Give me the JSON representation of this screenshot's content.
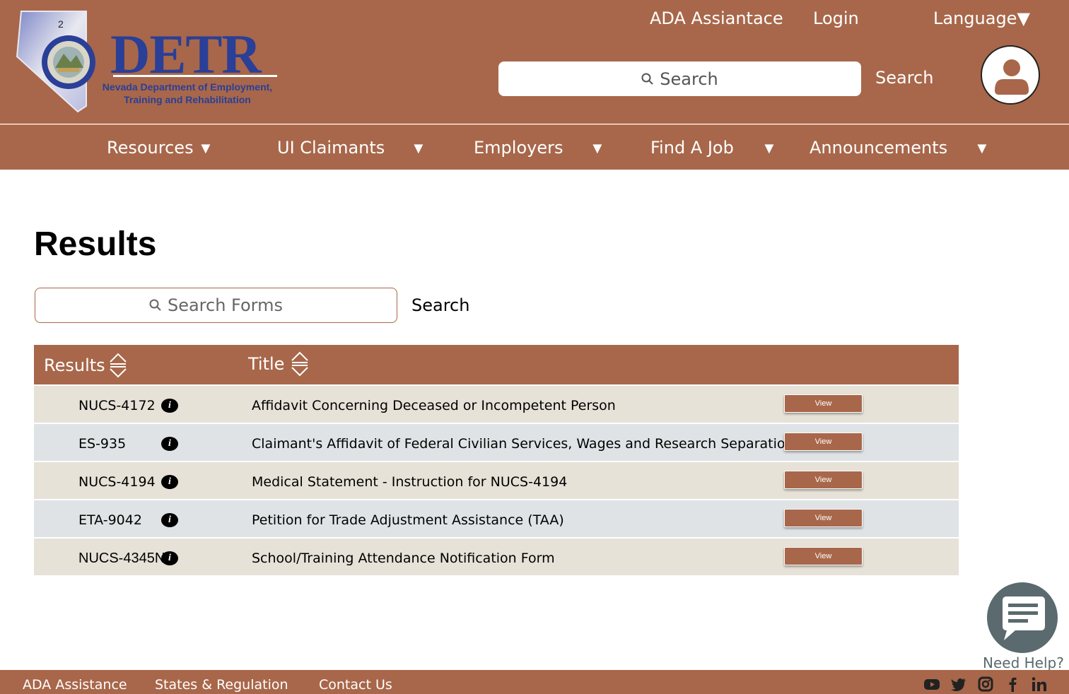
{
  "header": {
    "logo_number": "2",
    "logo_word": "DETR",
    "logo_subtitle_1": "Nevada Department of Employment,",
    "logo_subtitle_2": "Training and Rehabilitation",
    "links": {
      "ada": "ADA Assiantace",
      "login": "Login",
      "language": "Language▼"
    },
    "search": {
      "placeholder": "Search",
      "button": "Search"
    }
  },
  "nav": {
    "items": [
      {
        "label": "Resources",
        "arrow": "▼"
      },
      {
        "label": "UI Claimants",
        "arrow": "▼"
      },
      {
        "label": "Employers",
        "arrow": "▼"
      },
      {
        "label": "Find A Job",
        "arrow": "▼"
      },
      {
        "label": "Announcements",
        "arrow": "▼"
      }
    ]
  },
  "main": {
    "title": "Results",
    "search": {
      "placeholder": "Search Forms",
      "button": "Search"
    },
    "table": {
      "columns": [
        "Results",
        "Title"
      ],
      "rows": [
        {
          "id": "NUCS-4172",
          "title": "Affidavit Concerning Deceased or Incompetent Person",
          "action": "View"
        },
        {
          "id": "ES-935",
          "title": "Claimant's Affidavit of Federal Civilian Services, Wages and Research Separation",
          "action": "View"
        },
        {
          "id": "NUCS-4194",
          "title": "Medical Statement - Instruction for NUCS-4194",
          "action": "View"
        },
        {
          "id": "ETA-9042",
          "title": "Petition for Trade Adjustment Assistance (TAA)",
          "action": "View"
        },
        {
          "id": "NUCS-4345N",
          "title": "School/Training Attendance Notification Form",
          "action": "View"
        }
      ]
    }
  },
  "help": {
    "label": "Need Help?"
  },
  "footer": {
    "links": [
      "ADA Assistance",
      "States & Regulation",
      "Contact Us"
    ],
    "social_icons": [
      "youtube-icon",
      "twitter-icon",
      "instagram-icon",
      "facebook-icon",
      "linkedin-icon"
    ]
  },
  "colors": {
    "brand": "#a8674a",
    "logo_blue": "#2a3f97",
    "row_odd": "#e6e2d8",
    "row_even": "#dfe3e5",
    "help_bubble": "#5a6a6e"
  }
}
